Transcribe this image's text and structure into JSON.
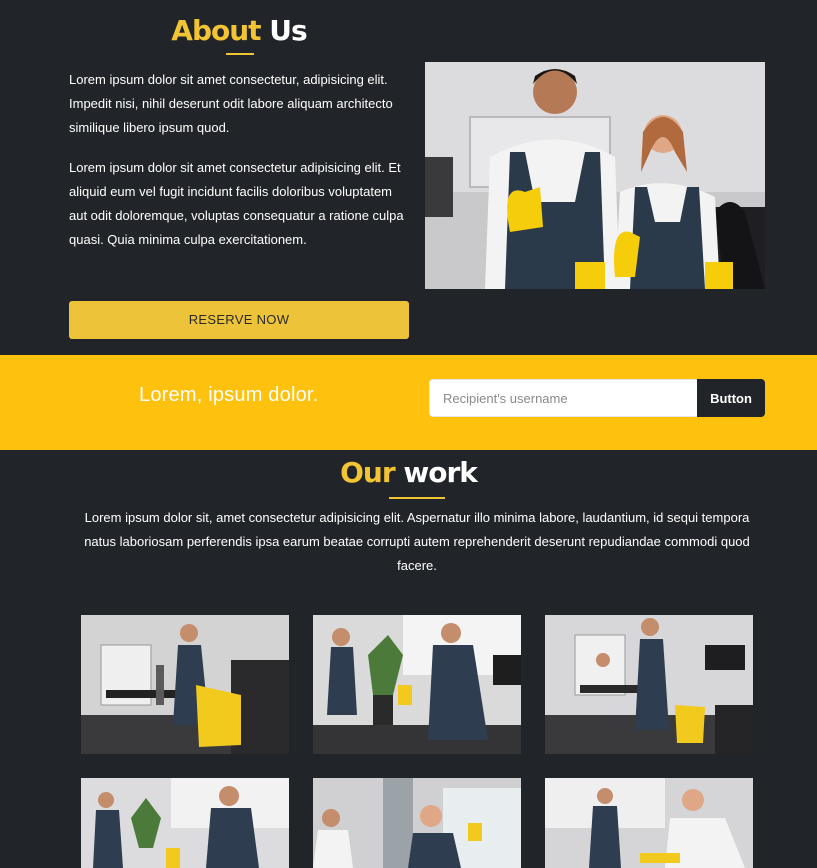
{
  "about": {
    "title_accent": "About",
    "title_plain": " Us",
    "paragraph1": "Lorem ipsum dolor sit amet consectetur, adipisicing elit. Impedit nisi, nihil deserunt odit labore aliquam architecto similique libero ipsum quod.",
    "paragraph2": "Lorem ipsum dolor sit amet consectetur adipisicing elit. Et aliquid eum vel fugit incidunt facilis doloribus voluptatem aut odit doloremque, voluptas consequatur a ratione culpa quasi. Quia minima culpa exercitationem.",
    "reserve_label": "RESERVE NOW"
  },
  "band": {
    "text": "Lorem, ipsum dolor.",
    "input_placeholder": "Recipient's username",
    "button_label": "Button"
  },
  "work": {
    "title_accent": "Our",
    "title_plain": " work",
    "description": "Lorem ipsum dolor sit, amet consectetur adipisicing elit. Aspernatur illo minima labore, laudantium, id sequi tempora natus laboriosam perferendis ipsa earum beatae corrupti autem reprehenderit deserunt repudiandae commodi quod facere."
  },
  "colors": {
    "background": "#212429",
    "accent_yellow": "#fdc10e",
    "button_yellow": "#edc33a",
    "title_yellow": "#f2c433"
  }
}
